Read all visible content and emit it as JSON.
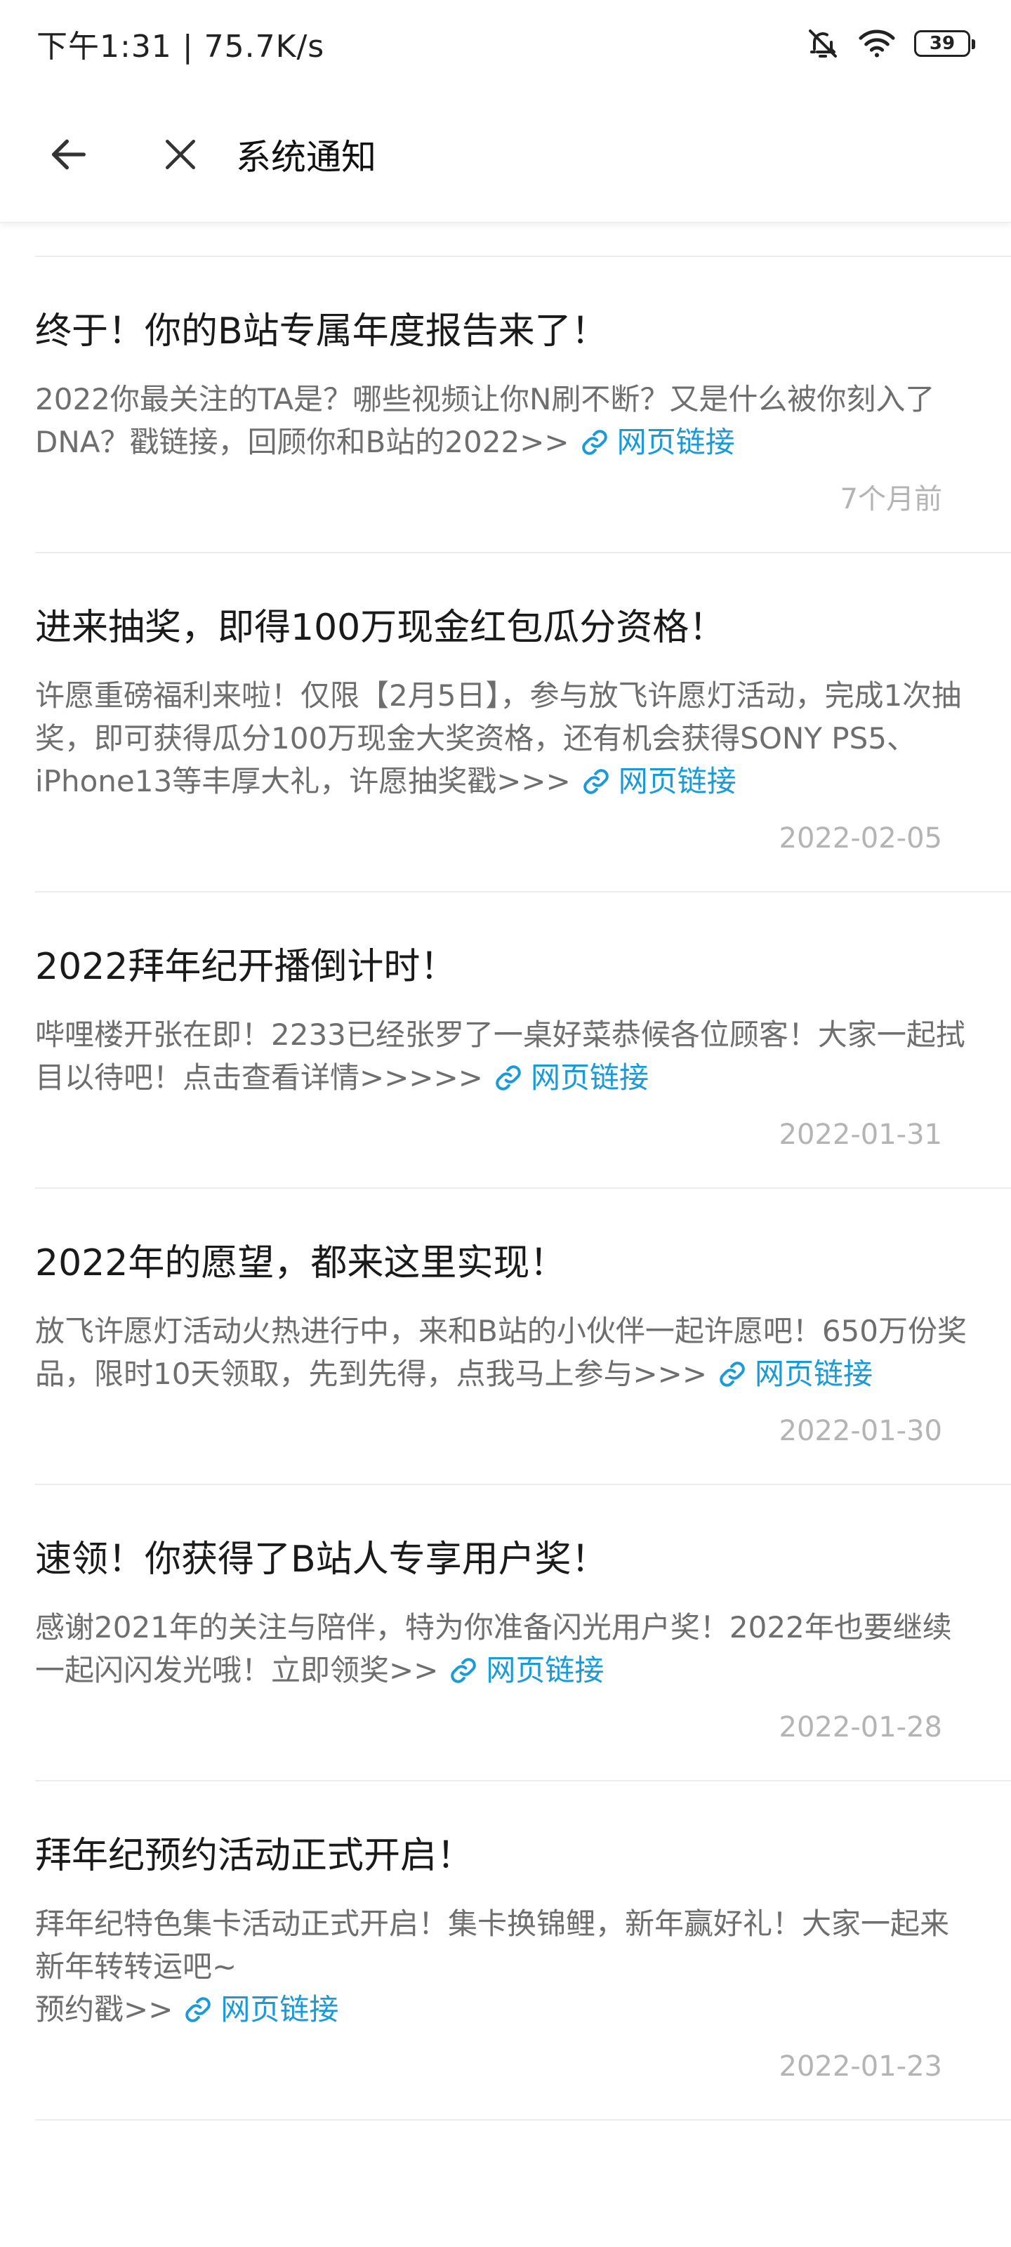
{
  "status_bar": {
    "time": "下午1:31",
    "separator": "|",
    "speed": "75.7K/s",
    "battery": "39"
  },
  "app_bar": {
    "title": "系统通知"
  },
  "link_label": "网页链接",
  "notices": [
    {
      "title": "终于！你的B站专属年度报告来了！",
      "body": "2022你最关注的TA是？哪些视频让你N刷不断？又是什么被你刻入了DNA？戳链接，回顾你和B站的2022>>",
      "time": "7个月前"
    },
    {
      "title": "进来抽奖，即得100万现金红包瓜分资格！",
      "body": "许愿重磅福利来啦！仅限【2月5日】，参与放飞许愿灯活动，完成1次抽奖，即可获得瓜分100万现金大奖资格，还有机会获得SONY PS5、iPhone13等丰厚大礼，许愿抽奖戳>>>",
      "time": "2022-02-05"
    },
    {
      "title": "2022拜年纪开播倒计时！",
      "body": "哔哩楼开张在即！2233已经张罗了一桌好菜恭候各位顾客！大家一起拭目以待吧！点击查看详情>>>>>",
      "time": "2022-01-31"
    },
    {
      "title": "2022年的愿望，都来这里实现！",
      "body": "放飞许愿灯活动火热进行中，来和B站的小伙伴一起许愿吧！650万份奖品，限时10天领取，先到先得，点我马上参与>>>",
      "time": "2022-01-30"
    },
    {
      "title": "速领！你获得了B站人专享用户奖！",
      "body": "感谢2021年的关注与陪伴，特为你准备闪光用户奖！2022年也要继续一起闪闪发光哦！立即领奖>>",
      "time": "2022-01-28"
    },
    {
      "title": "拜年纪预约活动正式开启！",
      "body": "拜年纪特色集卡活动正式开启！集卡换锦鲤，新年赢好礼！大家一起来新年转转运吧~\n预约戳>>",
      "time": "2022-01-23"
    }
  ]
}
